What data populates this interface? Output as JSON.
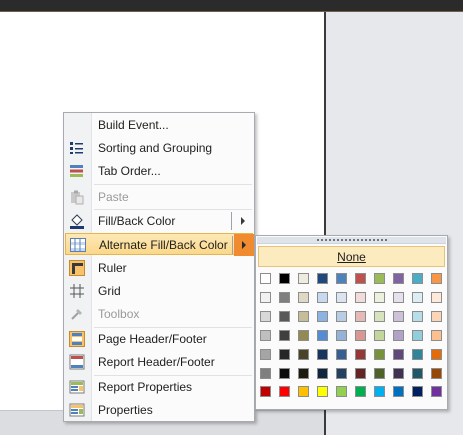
{
  "context_menu": {
    "items": [
      {
        "name": "build-event",
        "label": "Build Event...",
        "icon": "none",
        "disabled": false,
        "highlighted": false
      },
      {
        "name": "sorting-and-grouping",
        "label": "Sorting and Grouping",
        "icon": "sorting-grouping-icon",
        "disabled": false,
        "highlighted": false
      },
      {
        "name": "tab-order",
        "label": "Tab Order...",
        "icon": "tab-order-icon",
        "disabled": false,
        "highlighted": false
      },
      {
        "name": "paste",
        "label": "Paste",
        "icon": "paste-icon",
        "disabled": true,
        "highlighted": false
      },
      {
        "name": "fill-back-color",
        "label": "Fill/Back Color",
        "icon": "paint-bucket-icon",
        "disabled": false,
        "highlighted": false,
        "submenu": true
      },
      {
        "name": "alternate-fill-back-color",
        "label": "Alternate Fill/Back Color",
        "icon": "alternate-fill-icon",
        "disabled": false,
        "highlighted": true,
        "submenu": true
      },
      {
        "name": "ruler",
        "label": "Ruler",
        "icon": "ruler-icon",
        "disabled": false,
        "highlighted": false
      },
      {
        "name": "grid",
        "label": "Grid",
        "icon": "grid-icon",
        "disabled": false,
        "highlighted": false
      },
      {
        "name": "toolbox",
        "label": "Toolbox",
        "icon": "toolbox-icon",
        "disabled": true,
        "highlighted": false
      },
      {
        "name": "page-header-footer",
        "label": "Page Header/Footer",
        "icon": "page-header-footer-icon",
        "disabled": false,
        "highlighted": false
      },
      {
        "name": "report-header-footer",
        "label": "Report Header/Footer",
        "icon": "report-header-footer-icon",
        "disabled": false,
        "highlighted": false
      },
      {
        "name": "report-properties",
        "label": "Report Properties",
        "icon": "report-properties-icon",
        "disabled": false,
        "highlighted": false
      },
      {
        "name": "properties",
        "label": "Properties",
        "icon": "properties-icon",
        "disabled": false,
        "highlighted": false
      }
    ]
  },
  "palette": {
    "none_label": "None",
    "rows": [
      [
        "#ffffff",
        "#000000",
        "#eeece1",
        "#1f497d",
        "#4f81bd",
        "#c0504d",
        "#9bbb59",
        "#8064a2",
        "#4bacc6",
        "#f79646"
      ],
      [
        "#f2f2f2",
        "#7f7f7f",
        "#ddd9c3",
        "#c6d9f0",
        "#dbe5f1",
        "#f2dcdb",
        "#ebf1dd",
        "#e5e0ec",
        "#dbeef3",
        "#fdeada"
      ],
      [
        "#d8d8d8",
        "#595959",
        "#c4bd97",
        "#8db3e2",
        "#b8cce4",
        "#e5b9b7",
        "#d7e3bc",
        "#ccc1d9",
        "#b7dde8",
        "#fbd5b5"
      ],
      [
        "#bfbfbf",
        "#3f3f3f",
        "#938953",
        "#548dd4",
        "#95b3d7",
        "#d99694",
        "#c3d69b",
        "#b2a2c7",
        "#92cddc",
        "#fac08f"
      ],
      [
        "#a5a5a5",
        "#262626",
        "#494429",
        "#17365d",
        "#366092",
        "#953734",
        "#76923c",
        "#5f497a",
        "#31859b",
        "#e36c09"
      ],
      [
        "#7f7f7f",
        "#0c0c0c",
        "#1d1b10",
        "#0f243e",
        "#244061",
        "#632423",
        "#4f6128",
        "#3f3151",
        "#205867",
        "#974806"
      ],
      [
        "#c00000",
        "#ff0000",
        "#ffc000",
        "#ffff00",
        "#92d050",
        "#00b050",
        "#00b0f0",
        "#0070c0",
        "#002060",
        "#7030a0"
      ]
    ]
  }
}
